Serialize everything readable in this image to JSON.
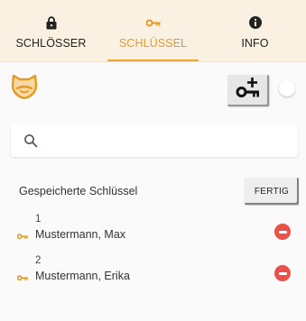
{
  "tabs": [
    {
      "label": "SCHLÖSSER",
      "icon": "lock-icon",
      "active": false
    },
    {
      "label": "SCHLÜSSEL",
      "icon": "key-icon",
      "active": true
    },
    {
      "label": "INFO",
      "icon": "info-icon",
      "active": false
    }
  ],
  "search": {
    "placeholder": "",
    "value": ""
  },
  "section": {
    "title": "Gespeicherte Schlüssel",
    "done_label": "FERTIG"
  },
  "keys": [
    {
      "number": "1",
      "name": "Mustermann, Max"
    },
    {
      "number": "2",
      "name": "Mustermann, Erika"
    }
  ],
  "colors": {
    "accent": "#e59a1f",
    "tabbar": "#fbf1e2",
    "delete": "#e8524a"
  }
}
